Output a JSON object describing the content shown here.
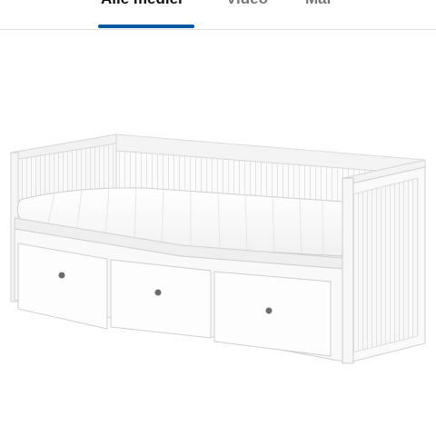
{
  "tabs": [
    {
      "label": "Alle medier",
      "active": true
    },
    {
      "label": "Video",
      "active": false
    },
    {
      "label": "Mål",
      "active": false
    }
  ],
  "colors": {
    "accent": "#0058a3",
    "active_text": "#111111",
    "inactive_text": "#767676",
    "divider": "#dfdfdf"
  },
  "media": {
    "image": "product-image",
    "icon": "daybed-with-three-drawers"
  }
}
